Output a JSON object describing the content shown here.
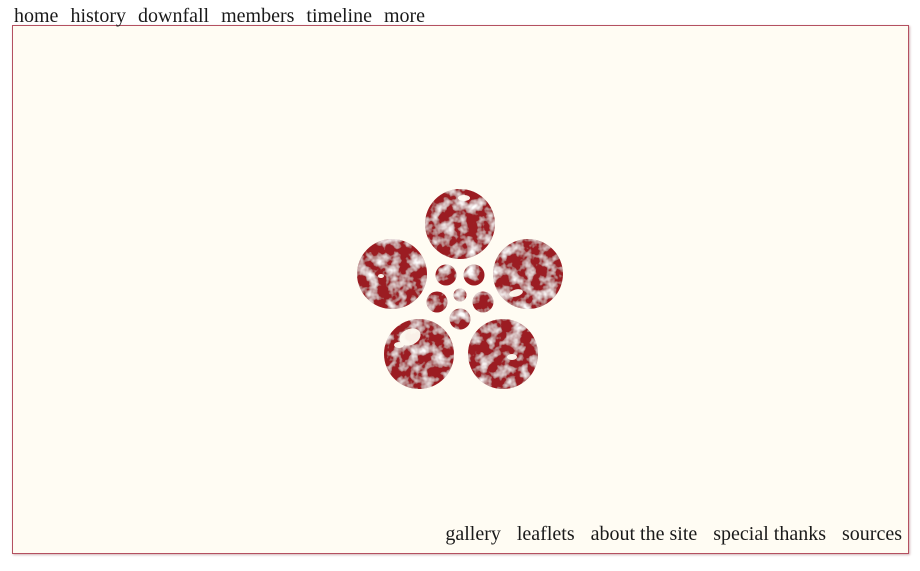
{
  "top_nav": {
    "items": [
      "home",
      "history",
      "downfall",
      "members",
      "timeline",
      "more"
    ]
  },
  "bottom_nav": {
    "items": [
      "gallery",
      "leaflets",
      "about the site",
      "special thanks",
      "sources"
    ]
  },
  "emblem": {
    "icon": "plum-blossom-crest-icon",
    "color": "#9b1b22"
  },
  "colors": {
    "page_background": "#fffcf3",
    "frame_border": "#b45060",
    "text": "#1a1a1a"
  }
}
